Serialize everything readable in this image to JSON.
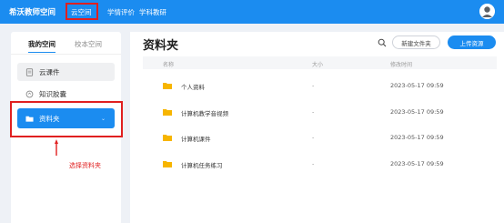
{
  "header": {
    "brand": "希沃教师空间",
    "nav": [
      {
        "label": "云空间"
      },
      {
        "label": "学情评价"
      },
      {
        "label": "学科教研"
      }
    ],
    "brand_color": "#1b8cf0"
  },
  "sidebar": {
    "tabs": [
      {
        "label": "我的空间",
        "active": true
      },
      {
        "label": "校本空间",
        "active": false
      }
    ],
    "items": [
      {
        "label": "云课件",
        "icon": "document-icon"
      },
      {
        "label": "知识胶囊",
        "icon": "capsule-icon"
      },
      {
        "label": "资料夹",
        "icon": "folder-icon",
        "active": true
      }
    ]
  },
  "annotation": {
    "label": "选择资料夹",
    "color": "#e02020"
  },
  "main": {
    "title": "资料夹",
    "new_folder_label": "新建文件夹",
    "upload_label": "上传资源",
    "columns": {
      "name": "名称",
      "size": "大小",
      "time": "修改时间"
    },
    "rows": [
      {
        "name": "个人资料",
        "size": "-",
        "time": "2023-05-17 09:59"
      },
      {
        "name": "计算机教学音视频",
        "size": "-",
        "time": "2023-05-17 09:59"
      },
      {
        "name": "计算机课件",
        "size": "-",
        "time": "2023-05-17 09:59"
      },
      {
        "name": "计算机任务练习",
        "size": "-",
        "time": "2023-05-17 09:59"
      }
    ]
  }
}
